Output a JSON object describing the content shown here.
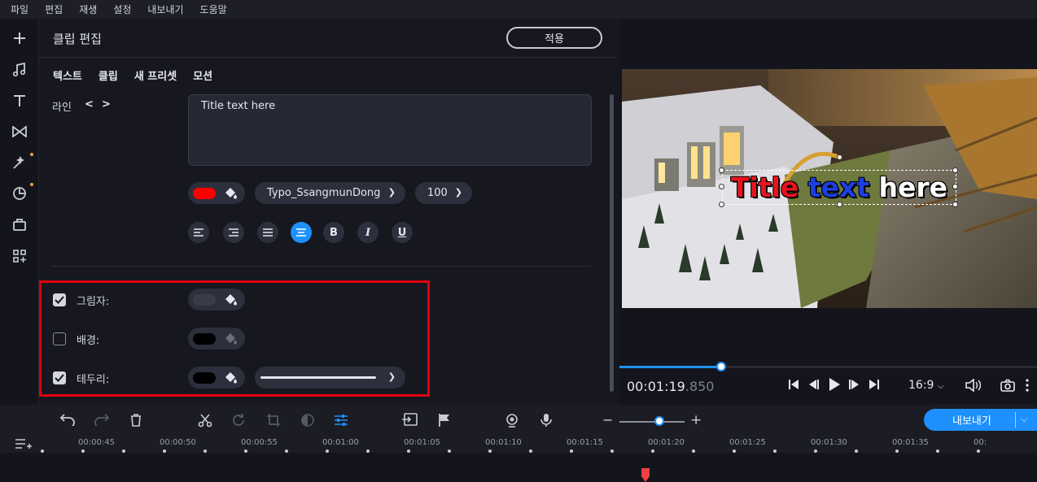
{
  "menu": [
    "파일",
    "편집",
    "재생",
    "설정",
    "내보내기",
    "도움말"
  ],
  "sidebar_icons": [
    "add-icon",
    "music-icon",
    "text-icon",
    "transitions-icon",
    "effects-icon",
    "stickers-icon",
    "tools-icon",
    "more-icon"
  ],
  "panel": {
    "title": "클립 편집",
    "apply_label": "적용",
    "tabs": [
      "텍스트",
      "클립",
      "새 프리셋",
      "모션"
    ],
    "line_label": "라인",
    "line_prev": "<",
    "line_next": ">",
    "text_value": "Title text here",
    "font_color": "#ff0000",
    "font_name": "Typo_SsangmunDong",
    "font_size": "100",
    "options": {
      "shadow": {
        "label": "그림자:",
        "checked": true,
        "color": "#3a3c48"
      },
      "background": {
        "label": "배경:",
        "checked": false,
        "color": "#000000"
      },
      "border": {
        "label": "테두리:",
        "checked": true,
        "color": "#000000"
      }
    }
  },
  "preview": {
    "title_words": [
      "Title",
      "text",
      "here"
    ],
    "title_colors": [
      "#e8141e",
      "#1c3fe0",
      "#ffffff"
    ],
    "timecode_main": "00:01:19",
    "timecode_ms": ".850",
    "progress": 0.24,
    "aspect": "16:9"
  },
  "toolbar": {
    "export_label": "내보내기",
    "zoom_minus": "−",
    "zoom_plus": "+",
    "zoom_level": 0.6
  },
  "timeline": {
    "ticks": [
      "00:00:45",
      "00:00:50",
      "00:00:55",
      "00:01:00",
      "00:01:05",
      "00:01:10",
      "00:01:15",
      "00:01:20",
      "00:01:25",
      "00:01:30",
      "00:01:35",
      "00:"
    ]
  }
}
